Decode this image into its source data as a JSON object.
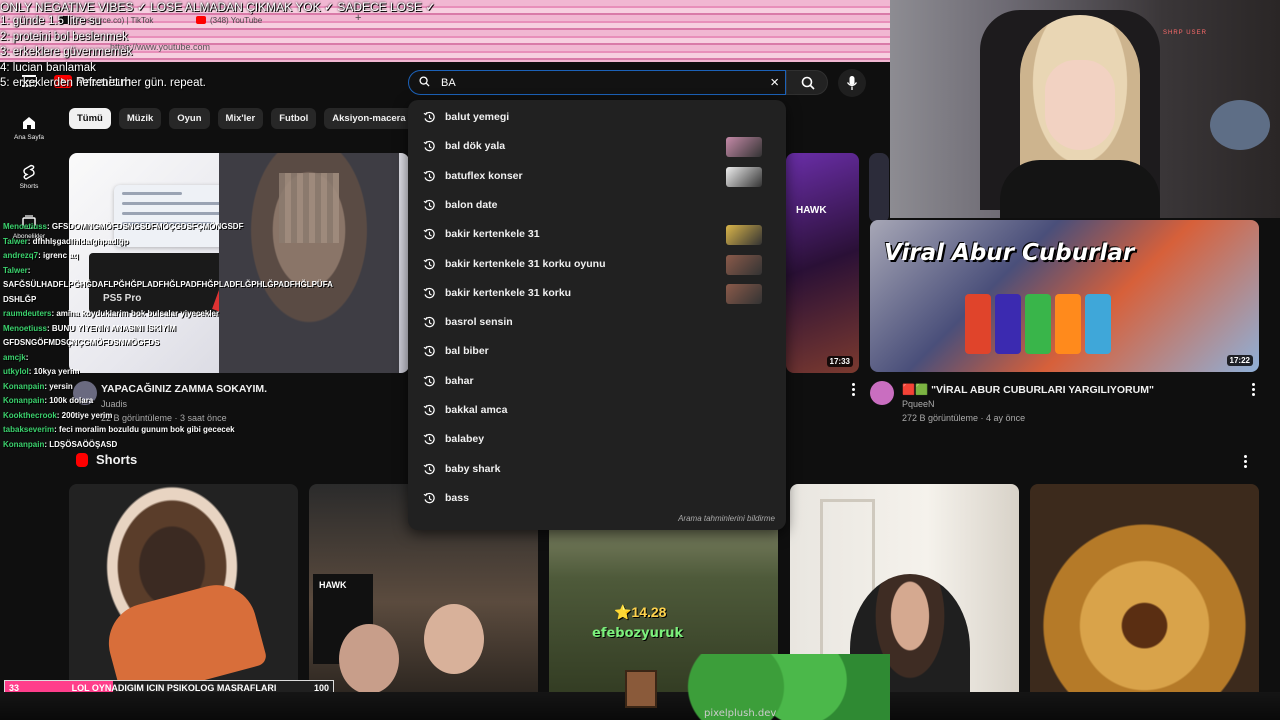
{
  "overlay": {
    "top_line": "ONLY NEGATIVE VIBES ✓ LOSE ALMADAN ÇIKMAK YOK ✓ SADECE LOSE ✓",
    "list": [
      "1: günde 1.5 litre su",
      "2: proteini bol beslenmek",
      "3: erkeklere güvenmemek",
      "4: lucian banlamak",
      "5: erkeklerden nefret et. her gün. repeat."
    ]
  },
  "browser": {
    "tabs": [
      {
        "label": "(Resource.co) | TikTok"
      },
      {
        "label": "(348) YouTube"
      }
    ],
    "new_tab": "+",
    "url": "https://www.youtube.com"
  },
  "masthead": {
    "logo_text": "Premium",
    "search_value": "BA",
    "clear": "×"
  },
  "sidebar": {
    "items": [
      {
        "label": "Ana Sayfa",
        "icon": "home-icon"
      },
      {
        "label": "Shorts",
        "icon": "shorts-icon"
      },
      {
        "label": "Abonelikler",
        "icon": "subscriptions-icon"
      }
    ]
  },
  "chips": [
    "Tümü",
    "Müzik",
    "Oyun",
    "Mix'ler",
    "Futbol",
    "Aksiyon-macera oyu"
  ],
  "videos": [
    {
      "title": "YAPACAĞINIZ ZAMMA SOKAYIM.",
      "channel": "Juadis",
      "meta": "22 B görüntüleme · 3 saat önce",
      "thumb_ps5": "PS5 Pro"
    },
    {
      "title": "🟥🟩 \"VİRAL ABUR CUBURLARI YARGILIYORUM\"",
      "channel": "PqueeN",
      "meta": "272 B görüntüleme · 4 ay önce",
      "duration": "17:22",
      "thumb_title": "Viral Abur Cuburlar"
    },
    {
      "duration": "17:33",
      "thumb_text": "HAWK"
    }
  ],
  "shorts": {
    "heading": "Shorts",
    "items": [
      {
        "name": "short-1"
      },
      {
        "name": "short-2",
        "box_text": "HAWK"
      },
      {
        "name": "short-3",
        "tag": "⭐14.28",
        "user": "efebozyuruk"
      },
      {
        "name": "short-4"
      },
      {
        "name": "short-5"
      }
    ]
  },
  "suggestions": {
    "items": [
      {
        "text": "balut yemegi",
        "thumb": false
      },
      {
        "text": "bal dök yala",
        "thumb": true,
        "color": "#c58aa8"
      },
      {
        "text": "batuflex konser",
        "thumb": true,
        "color": "#eeeeee"
      },
      {
        "text": "balon date",
        "thumb": false
      },
      {
        "text": "bakir kertenkele 31",
        "thumb": true,
        "color": "#d9b54a"
      },
      {
        "text": "bakir kertenkele 31 korku oyunu",
        "thumb": true,
        "color": "#8a5a4a"
      },
      {
        "text": "bakir kertenkele 31 korku",
        "thumb": true,
        "color": "#8a5a4a"
      },
      {
        "text": "basrol sensin",
        "thumb": false
      },
      {
        "text": "bal biber",
        "thumb": false
      },
      {
        "text": "bahar",
        "thumb": false
      },
      {
        "text": "bakkal amca",
        "thumb": false
      },
      {
        "text": "balabey",
        "thumb": false
      },
      {
        "text": "baby shark",
        "thumb": false
      },
      {
        "text": "bass",
        "thumb": false
      }
    ],
    "report": "Arama tahminlerini bildirme"
  },
  "webcam": {
    "neon": "SHRP USER"
  },
  "chat": [
    {
      "user": "Menoetiuss",
      "msg": ": GFSDOMNGMÖFDSNGSDFMÖÇGDSFÇMÖNGSDF"
    },
    {
      "user": "Talwer",
      "msg": ": dfhhlşgadfhldafghpadlğp"
    },
    {
      "user": "andrezq7",
      "msg": ": igrenc aq"
    },
    {
      "user": "Talwer",
      "msg": ":"
    },
    {
      "user": "",
      "msg": "SAFĞSÜLHADFLPĞHĞDAFLPĞHĞPLADFHĞLPADFHĞPLADFLĞPHLĞPADFHĞLPÜFA"
    },
    {
      "user": "",
      "msg": "DSHLĞP"
    },
    {
      "user": "raumdeuters",
      "msg": ": amina koyduklarim bok bulsalar yiyecekler"
    },
    {
      "user": "Menoetiuss",
      "msg": ": BUNU YİYENİN ANASINI İSKİYİM"
    },
    {
      "user": "",
      "msg": "GFDSNGÖFMDSÇNÇGMÖFDSNMÖGFDS"
    },
    {
      "user": "amcjk",
      "msg": ":"
    },
    {
      "user": "utkylol",
      "msg": ": 10kya yerim"
    },
    {
      "user": "Konanpain",
      "msg": ": yersin"
    },
    {
      "user": "Konanpain",
      "msg": ": 100k dolara"
    },
    {
      "user": "Kookthecrook",
      "msg": ": 200tiye yerim"
    },
    {
      "user": "tabakseverim",
      "msg": ": feci moralim bozuldu gunum bok gibi gececek"
    },
    {
      "user": "Konanpain",
      "msg": ": LDŞÖSAÖÖŞASD"
    }
  ],
  "sub_goal": {
    "current": "33",
    "label": "LOL OYNADIGIM ICIN PSIKOLOG MASRAFLARI",
    "target": "100",
    "progress": 0.33
  },
  "stream_footer": {
    "brand": "pixelplush.dev"
  }
}
